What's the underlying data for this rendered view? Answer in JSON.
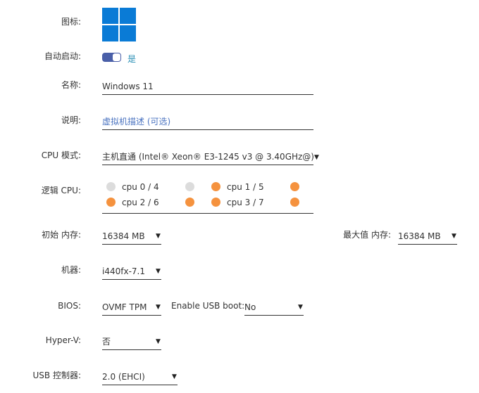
{
  "icon": {
    "label": "图标:",
    "name": "windows-logo-icon",
    "color": "#0a7bd6"
  },
  "autostart": {
    "label": "自动启动:",
    "value_text": "是",
    "enabled": true,
    "accent": "#4a5fa8"
  },
  "name": {
    "label": "名称:",
    "value": "Windows 11"
  },
  "description": {
    "label": "说明:",
    "placeholder": "虚拟机描述 (可选)"
  },
  "cpu_mode": {
    "label": "CPU 模式:",
    "value": "主机直通 (Intel® Xeon® E3-1245 v3 @ 3.40GHz@)"
  },
  "logical_cpu": {
    "label": "逻辑 CPU:",
    "rows": [
      {
        "text": "cpu 0 / 4",
        "first": false,
        "second": false
      },
      {
        "text": "cpu 1 / 5",
        "first": true,
        "second": true
      },
      {
        "text": "cpu 2 / 6",
        "first": true,
        "second": true
      },
      {
        "text": "cpu 3 / 7",
        "first": true,
        "second": true
      }
    ],
    "on_color": "#f5923e",
    "off_color": "#dcdcdc"
  },
  "memory": {
    "initial_label": "初始 内存:",
    "initial_value": "16384 MB",
    "max_label": "最大值 内存:",
    "max_value": "16384 MB"
  },
  "machine": {
    "label": "机器:",
    "value": "i440fx-7.1"
  },
  "bios": {
    "label": "BIOS:",
    "value": "OVMF TPM",
    "usb_boot_label": "Enable USB boot:",
    "usb_boot_value": "No"
  },
  "hyperv": {
    "label": "Hyper-V:",
    "value": "否"
  },
  "usb_controller": {
    "label": "USB 控制器:",
    "value": "2.0 (EHCI)"
  }
}
